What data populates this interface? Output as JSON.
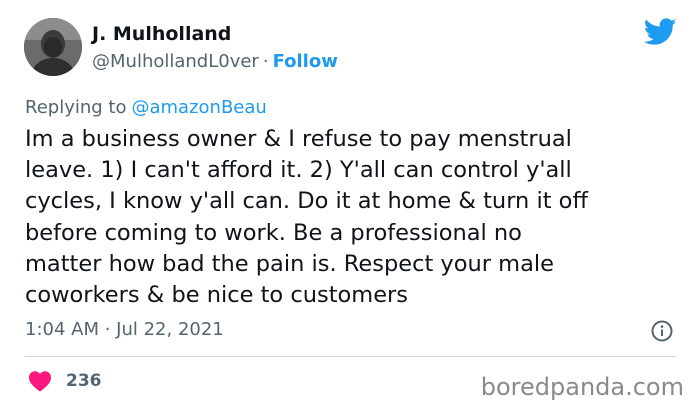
{
  "author": {
    "display_name": "J. Mulholland",
    "handle": "@MulhollandL0ver",
    "separator": "·",
    "follow_label": "Follow"
  },
  "reply": {
    "prefix": "Replying to",
    "mention": "@amazonBeau"
  },
  "tweet": {
    "text": "Im a business owner & I refuse to pay menstrual\nleave. 1) I can't afford it. 2) Y'all can control y'all\ncycles, I know y'all can. Do it at home & turn it off\nbefore coming to work. Be a professional no\nmatter how bad the pain is. Respect your male\ncoworkers & be nice to customers",
    "timestamp": "1:04 AM · Jul 22, 2021",
    "like_count": "236"
  },
  "watermark": "boredpanda.com",
  "colors": {
    "accent": "#1d9bf0",
    "heart": "#f91880",
    "secondary_text": "#536471"
  },
  "icons": [
    "twitter-bird-icon",
    "info-icon",
    "heart-icon"
  ]
}
